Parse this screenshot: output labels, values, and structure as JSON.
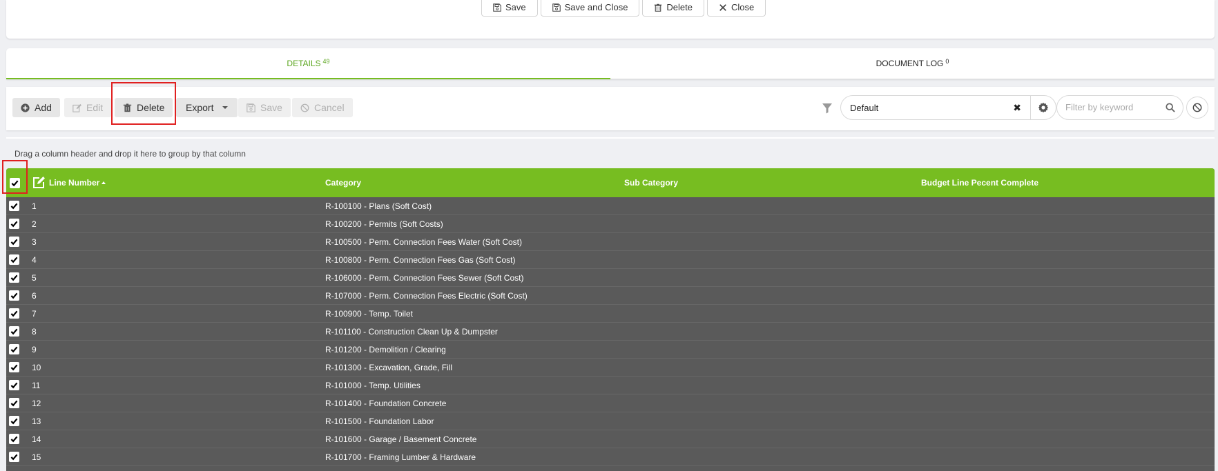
{
  "top_actions": [
    {
      "id": "save",
      "label": "Save",
      "icon": "floppy-icon"
    },
    {
      "id": "save-close",
      "label": "Save and Close",
      "icon": "floppy-icon"
    },
    {
      "id": "delete",
      "label": "Delete",
      "icon": "trash-icon"
    },
    {
      "id": "close",
      "label": "Close",
      "icon": "x-icon"
    }
  ],
  "tabs": [
    {
      "label": "DETAILS",
      "count": "49",
      "active": true
    },
    {
      "label": "DOCUMENT LOG",
      "count": "0",
      "active": false
    }
  ],
  "toolbar": {
    "add": "Add",
    "edit": "Edit",
    "delete": "Delete",
    "export": "Export",
    "save": "Save",
    "cancel": "Cancel"
  },
  "view_selector": {
    "value": "Default"
  },
  "keyword_filter": {
    "placeholder": "Filter by keyword"
  },
  "group_hint": "Drag a column header and drop it here to group by that column",
  "grid": {
    "columns": [
      "Line Number",
      "Category",
      "Sub Category",
      "Budget Line Pecent Complete"
    ],
    "rows": [
      {
        "line": "1",
        "category": "R-100100 - Plans (Soft Cost)"
      },
      {
        "line": "2",
        "category": "R-100200 - Permits (Soft Costs)"
      },
      {
        "line": "3",
        "category": "R-100500 - Perm. Connection Fees Water (Soft Cost)"
      },
      {
        "line": "4",
        "category": "R-100800 - Perm. Connection Fees Gas (Soft Cost)"
      },
      {
        "line": "5",
        "category": "R-106000 - Perm. Connection Fees Sewer (Soft Cost)"
      },
      {
        "line": "6",
        "category": "R-107000 - Perm. Connection Fees Electric (Soft Cost)"
      },
      {
        "line": "7",
        "category": "R-100900 - Temp. Toilet"
      },
      {
        "line": "8",
        "category": "R-101100 - Construction Clean Up & Dumpster"
      },
      {
        "line": "9",
        "category": "R-101200 - Demolition / Clearing"
      },
      {
        "line": "10",
        "category": "R-101300 - Excavation, Grade, Fill"
      },
      {
        "line": "11",
        "category": "R-101000 - Temp. Utilities"
      },
      {
        "line": "12",
        "category": "R-101400 - Foundation Concrete"
      },
      {
        "line": "13",
        "category": "R-101500 - Foundation Labor"
      },
      {
        "line": "14",
        "category": "R-101600 - Garage / Basement Concrete"
      },
      {
        "line": "15",
        "category": "R-101700 - Framing Lumber & Hardware"
      }
    ]
  },
  "colors": {
    "accent_green": "#77bd21",
    "grid_row_bg": "#5a5a5a",
    "highlight_red": "#e02020"
  }
}
